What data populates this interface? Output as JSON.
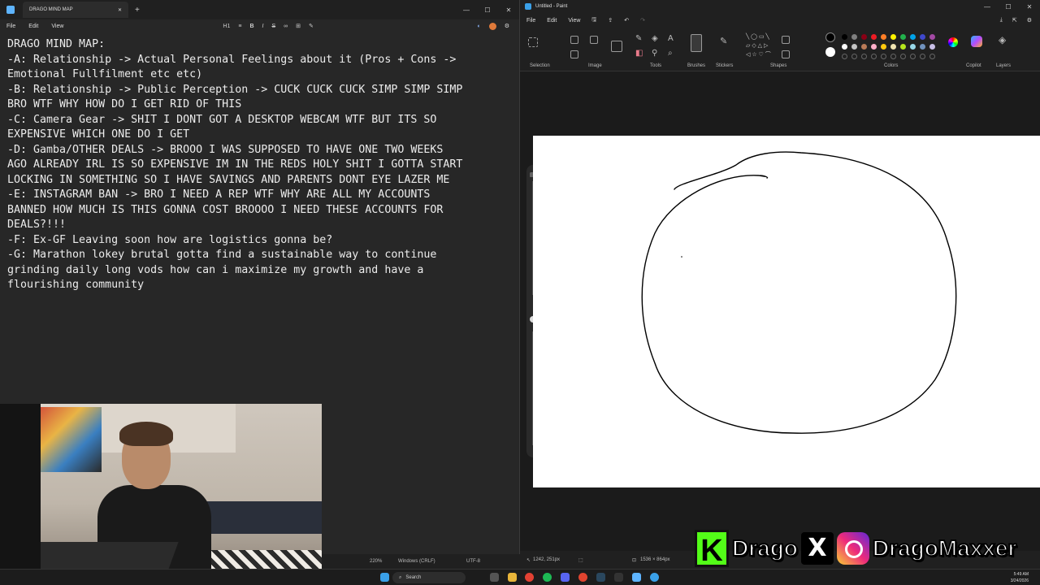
{
  "notepad": {
    "tab_title": "DRAGO MIND MAP",
    "menu": [
      "File",
      "Edit",
      "View"
    ],
    "heading_style": "H1",
    "lines": [
      "DRAGO MIND MAP:",
      "-A: Relationship -> Actual Personal Feelings about it (Pros + Cons ->",
      "Emotional Fullfilment etc etc)",
      "-B: Relationship -> Public Perception -> CUCK CUCK CUCK SIMP SIMP SIMP",
      "BRO WTF WHY HOW DO I GET RID OF THIS",
      "-C: Camera Gear -> SHIT I DONT GOT A DESKTOP WEBCAM WTF BUT ITS SO",
      "EXPENSIVE WHICH ONE DO I GET",
      "-D: Gamba/OTHER DEALS -> BROOO I WAS SUPPOSED TO HAVE ONE TWO WEEKS",
      "AGO ALREADY IRL IS SO EXPENSIVE IM IN THE REDS HOLY SHIT I GOTTA START",
      "LOCKING IN SOMETHING SO I HAVE SAVINGS AND PARENTS DONT EYE LAZER ME",
      "-E: INSTAGRAM BAN -> BRO I NEED A REP WTF WHY ARE ALL MY ACCOUNTS",
      "BANNED HOW MUCH IS THIS GONNA COST BROOOO I NEED THESE ACCOUNTS FOR",
      "DEALS?!!!",
      "-F: Ex-GF Leaving soon how are logistics gonna be?",
      "-G: Marathon lokey brutal gotta find a sustainable way to continue",
      "grinding daily long vods how can i maximize my growth and have a",
      "flourishing community"
    ],
    "status": {
      "zoom": "220%",
      "line_ending": "Windows (CRLF)",
      "encoding": "UTF-8"
    }
  },
  "paint": {
    "title": "Untitled - Paint",
    "menu": [
      "File",
      "Edit",
      "View"
    ],
    "groups": [
      "Selection",
      "Image",
      "Tools",
      "Brushes",
      "Stickers",
      "Shapes",
      "Colors",
      "Copilot",
      "Layers"
    ],
    "colors": [
      "#000000",
      "#7f7f7f",
      "#880015",
      "#ed1c24",
      "#ff7f27",
      "#fff200",
      "#22b14c",
      "#00a2e8",
      "#3f48cc",
      "#a349a4",
      "#ffffff",
      "#c3c3c3",
      "#b97a57",
      "#ffaec9",
      "#ffc90e",
      "#efe4b0",
      "#b5e61d",
      "#99d9ea",
      "#7092be",
      "#c8bfe7"
    ],
    "status": {
      "cursor_pos": "1242, 251px",
      "canvas_size": "1536 × 864px"
    }
  },
  "overlay": {
    "kick_letter": "K",
    "kick_name": "Drago",
    "x_letter": "X",
    "ig_name": "DragoMaxxer"
  },
  "taskbar": {
    "search": "Search",
    "time": "5:49 AM",
    "date": "3/24/2026"
  }
}
